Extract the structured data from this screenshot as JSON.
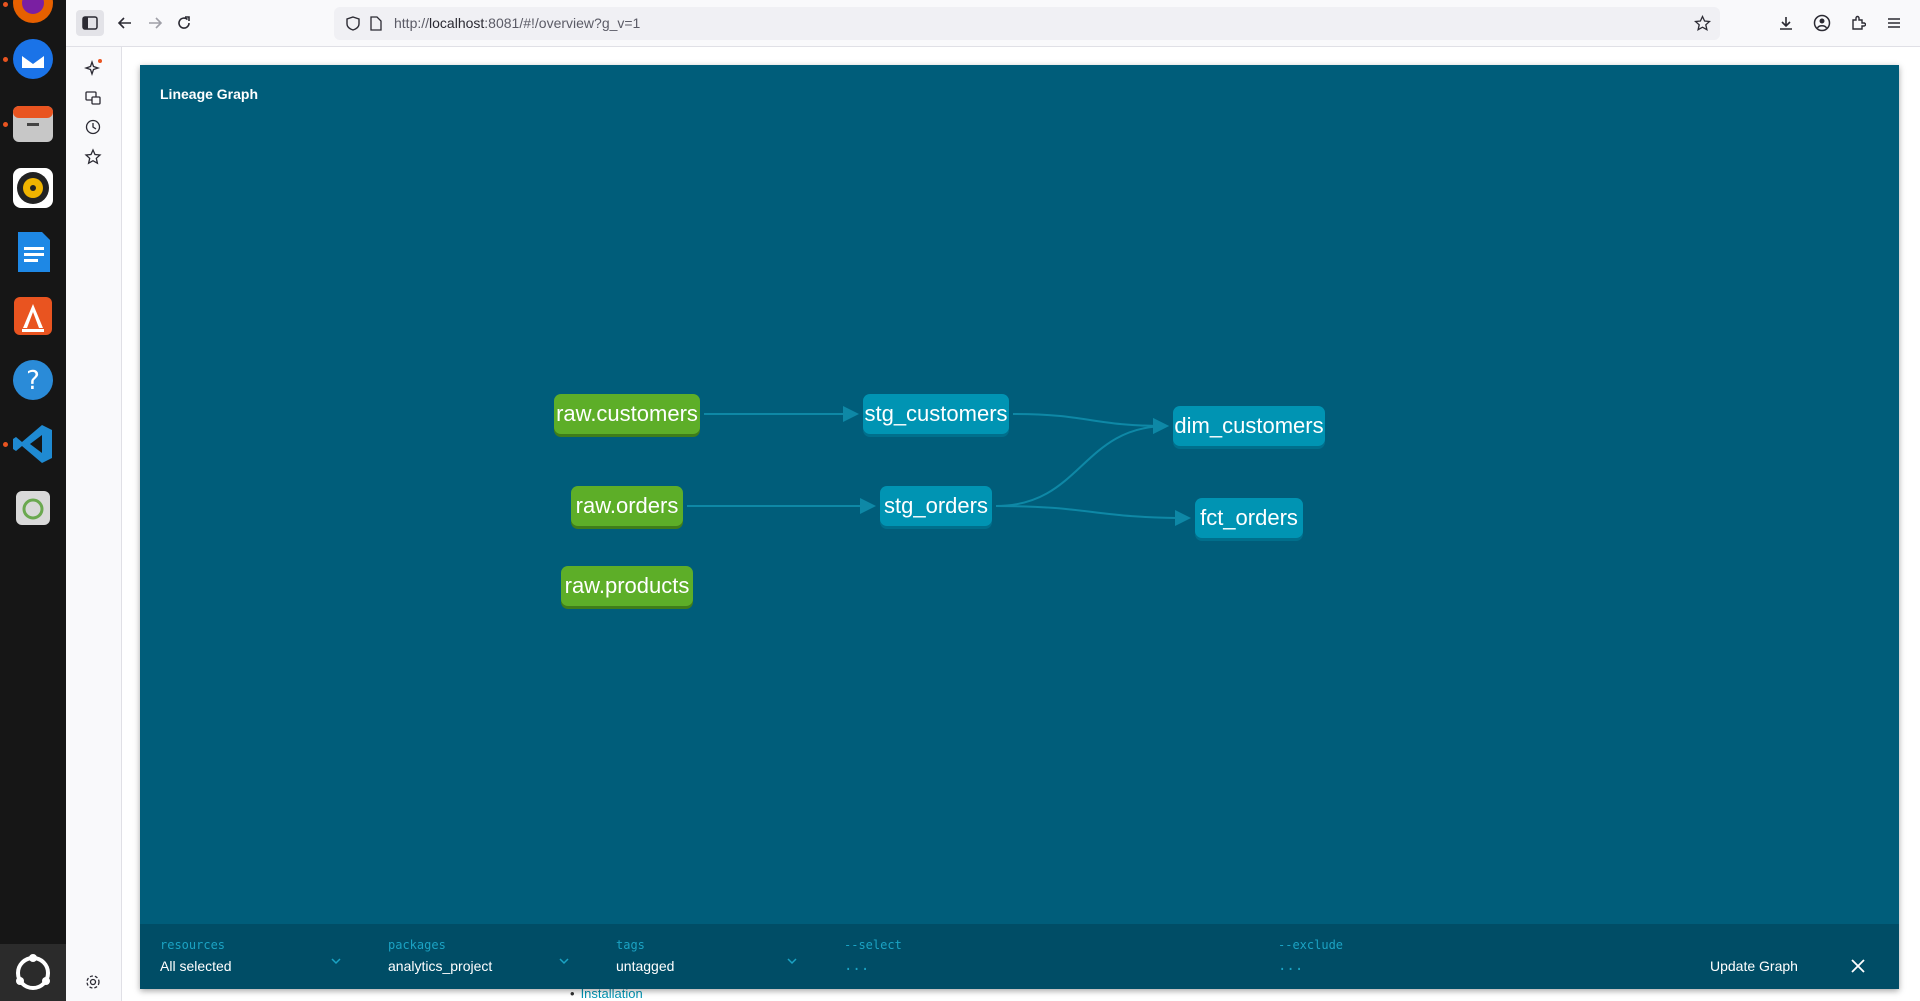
{
  "dock": {
    "apps": [
      {
        "name": "firefox",
        "color": "#e66000"
      },
      {
        "name": "thunderbird",
        "color": "#1a73e8"
      },
      {
        "name": "files",
        "color": "#e95420"
      },
      {
        "name": "rhythmbox",
        "color": "#f0b400"
      },
      {
        "name": "writer",
        "color": "#1e88e5"
      },
      {
        "name": "app-center",
        "color": "#e95420"
      },
      {
        "name": "help",
        "color": "#2a8bd8"
      },
      {
        "name": "vscode",
        "color": "#1f8ad2"
      },
      {
        "name": "trash",
        "color": "#6aa84f"
      }
    ]
  },
  "browser": {
    "url_scheme": "http://",
    "url_host": "localhost",
    "url_rest": ":8081/#!/overview?g_v=1"
  },
  "page": {
    "partial_link": "Installation"
  },
  "modal": {
    "title": "Lineage Graph",
    "nodes": [
      {
        "id": "raw_customers",
        "label": "raw.customers",
        "kind": "source",
        "color": "#5dae28"
      },
      {
        "id": "raw_orders",
        "label": "raw.orders",
        "kind": "source",
        "color": "#5dae28"
      },
      {
        "id": "raw_products",
        "label": "raw.products",
        "kind": "source",
        "color": "#5dae28"
      },
      {
        "id": "stg_customers",
        "label": "stg_customers",
        "kind": "model",
        "color": "#0094b3"
      },
      {
        "id": "stg_orders",
        "label": "stg_orders",
        "kind": "model",
        "color": "#0094b3"
      },
      {
        "id": "dim_customers",
        "label": "dim_customers",
        "kind": "model",
        "color": "#0094b3"
      },
      {
        "id": "fct_orders",
        "label": "fct_orders",
        "kind": "model",
        "color": "#0094b3"
      }
    ],
    "edges": [
      {
        "from": "raw_customers",
        "to": "stg_customers"
      },
      {
        "from": "raw_orders",
        "to": "stg_orders"
      },
      {
        "from": "stg_customers",
        "to": "dim_customers"
      },
      {
        "from": "stg_orders",
        "to": "dim_customers"
      },
      {
        "from": "stg_orders",
        "to": "fct_orders"
      }
    ]
  },
  "filters": {
    "resources": {
      "label": "resources",
      "value": "All selected"
    },
    "packages": {
      "label": "packages",
      "value": "analytics_project"
    },
    "tags": {
      "label": "tags",
      "value": "untagged"
    },
    "select": {
      "label": "--select",
      "placeholder": "..."
    },
    "exclude": {
      "label": "--exclude",
      "placeholder": "..."
    },
    "update_button": "Update Graph"
  }
}
